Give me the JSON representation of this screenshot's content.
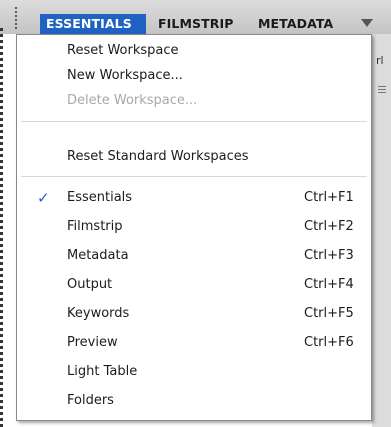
{
  "tabs": [
    {
      "label": "ESSENTIALS",
      "active": true
    },
    {
      "label": "FILMSTRIP",
      "active": false
    },
    {
      "label": "METADATA",
      "active": false
    }
  ],
  "underlay_text": "rl",
  "colors": {
    "active_tab": "#1f62c1",
    "disabled_text": "#a8a8a8",
    "checkmark": "#2a5fb8"
  },
  "menu": {
    "group1": [
      {
        "label": "Reset Workspace",
        "enabled": true
      },
      {
        "label": "New Workspace...",
        "enabled": true
      },
      {
        "label": "Delete Workspace...",
        "enabled": false
      }
    ],
    "group2": [
      {
        "label": "Reset Standard Workspaces",
        "enabled": true
      }
    ],
    "workspaces": [
      {
        "label": "Essentials",
        "shortcut": "Ctrl+F1",
        "checked": true
      },
      {
        "label": "Filmstrip",
        "shortcut": "Ctrl+F2",
        "checked": false
      },
      {
        "label": "Metadata",
        "shortcut": "Ctrl+F3",
        "checked": false
      },
      {
        "label": "Output",
        "shortcut": "Ctrl+F4",
        "checked": false
      },
      {
        "label": "Keywords",
        "shortcut": "Ctrl+F5",
        "checked": false
      },
      {
        "label": "Preview",
        "shortcut": "Ctrl+F6",
        "checked": false
      },
      {
        "label": "Light Table",
        "shortcut": "",
        "checked": false
      },
      {
        "label": "Folders",
        "shortcut": "",
        "checked": false
      }
    ],
    "check_glyph": "✓"
  }
}
